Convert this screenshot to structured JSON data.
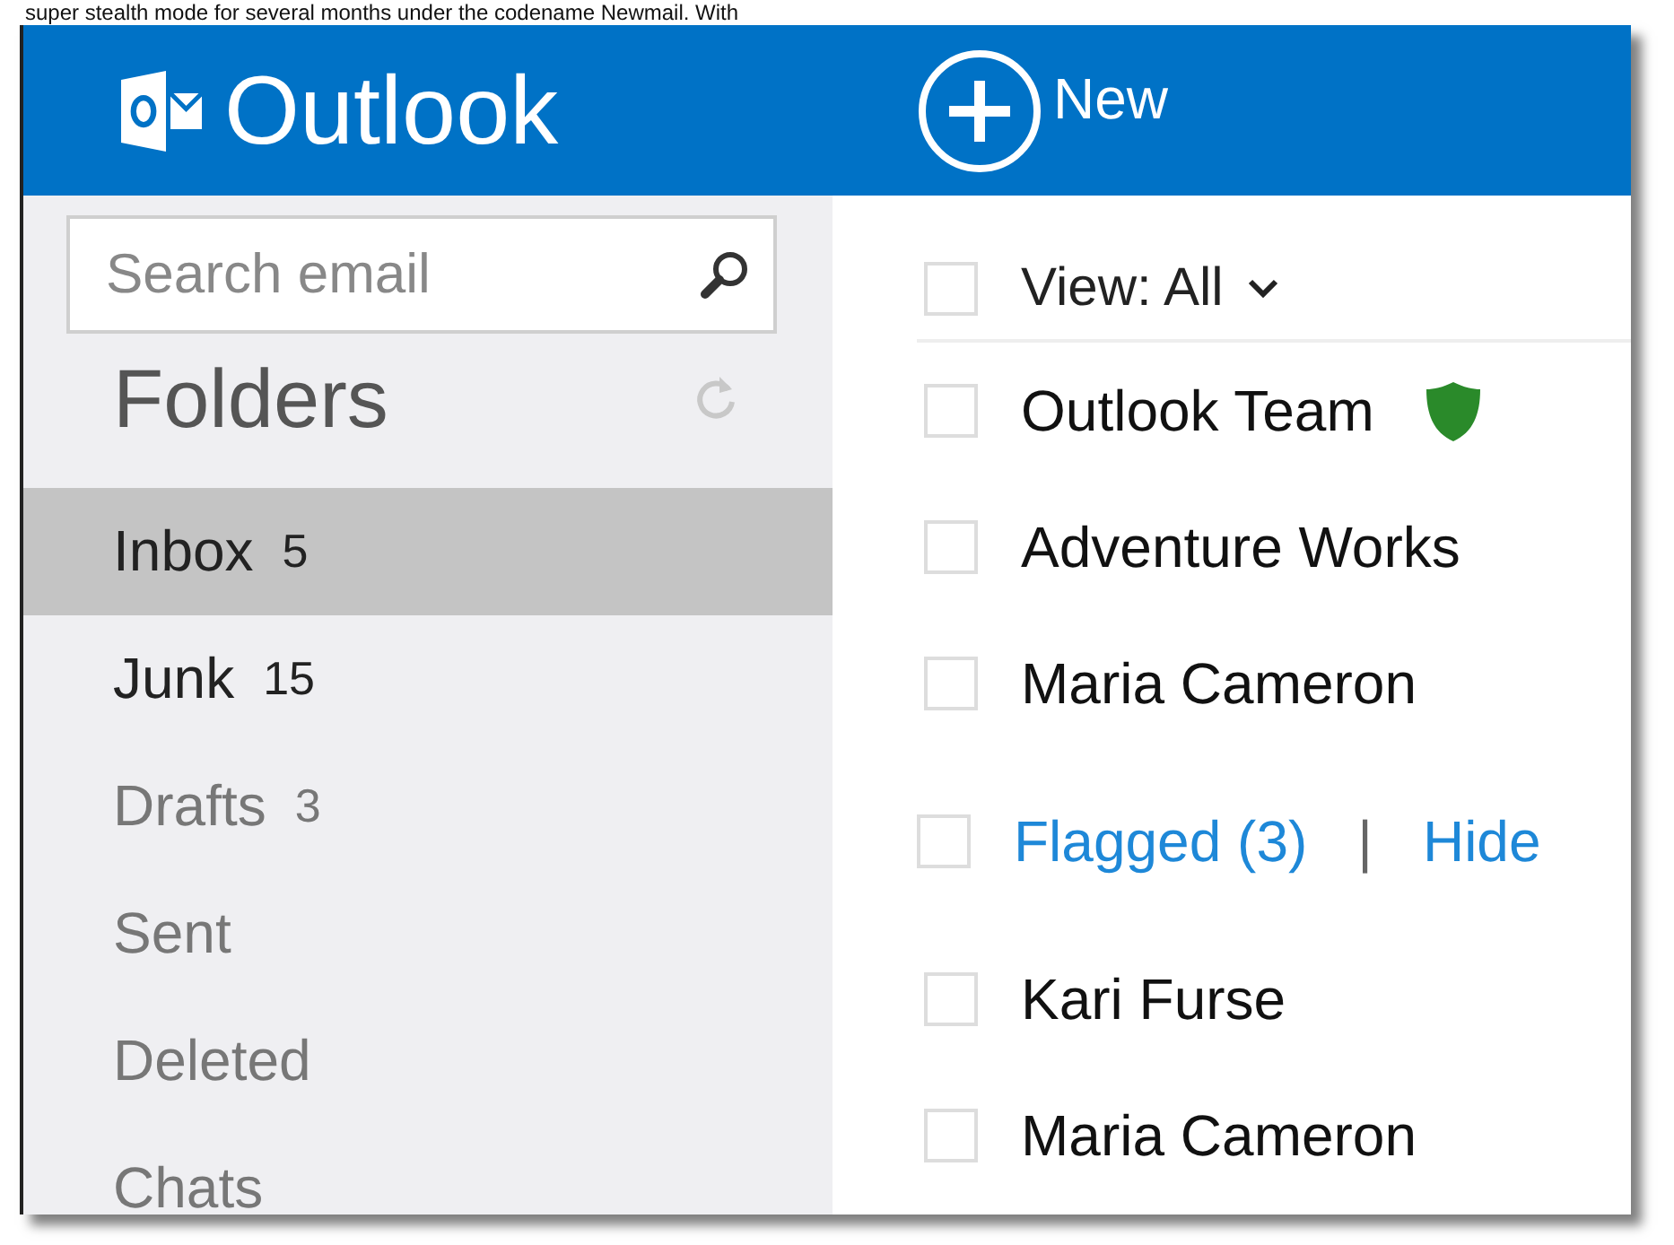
{
  "article_text": "super stealth mode for several months under the codename Newmail. With",
  "header": {
    "app_name": "Outlook",
    "new_button": "New"
  },
  "search": {
    "placeholder": "Search email"
  },
  "folders_heading": "Folders",
  "folders": [
    {
      "name": "Inbox",
      "count": "5",
      "selected": true,
      "unread": true
    },
    {
      "name": "Junk",
      "count": "15",
      "selected": false,
      "unread": true
    },
    {
      "name": "Drafts",
      "count": "3",
      "selected": false,
      "unread": false
    },
    {
      "name": "Sent",
      "selected": false,
      "unread": false
    },
    {
      "name": "Deleted",
      "selected": false,
      "unread": false
    },
    {
      "name": "Chats",
      "selected": false,
      "unread": false
    }
  ],
  "view_filter": {
    "label": "View: All",
    "checked": false
  },
  "messages": [
    {
      "kind": "message",
      "sender": "Outlook Team",
      "verified": true,
      "checked": false
    },
    {
      "kind": "message",
      "sender": "Adventure Works",
      "verified": false,
      "checked": false
    },
    {
      "kind": "message",
      "sender": "Maria Cameron",
      "verified": false,
      "checked": false
    },
    {
      "kind": "flagged",
      "link": "Flagged (3)",
      "separator": "|",
      "action": "Hide",
      "checked": false
    },
    {
      "kind": "message",
      "sender": "Kari Furse",
      "verified": false,
      "checked": false
    },
    {
      "kind": "message",
      "sender": "Maria Cameron",
      "verified": false,
      "checked": false
    }
  ]
}
